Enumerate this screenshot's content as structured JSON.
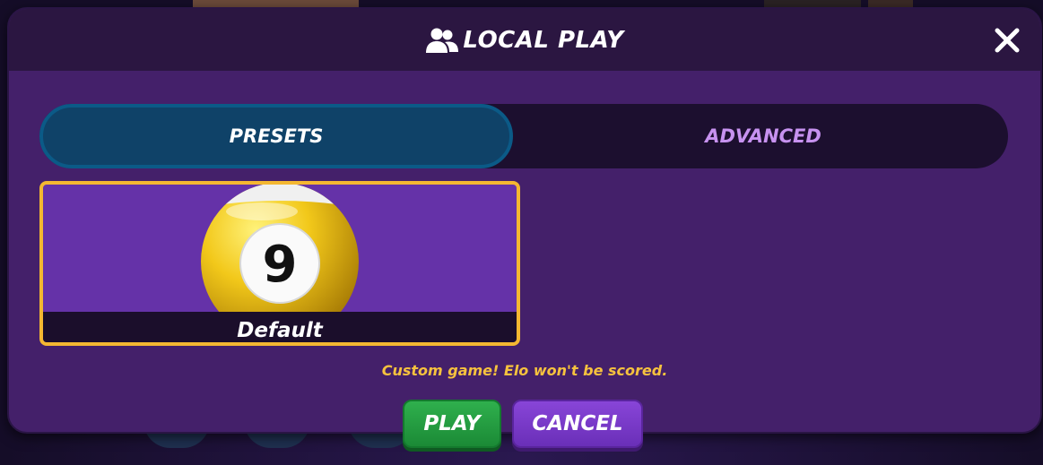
{
  "dialog": {
    "title": "LOCAL PLAY",
    "title_icon": "users-icon",
    "close_icon": "close-icon"
  },
  "tabs": [
    {
      "label": "PRESETS",
      "active": true
    },
    {
      "label": "ADVANCED",
      "active": false
    }
  ],
  "presets": [
    {
      "label": "Default",
      "ball_number": "9",
      "selected": true
    }
  ],
  "notice": "Custom game! Elo won't be scored.",
  "buttons": {
    "play": "PLAY",
    "cancel": "CANCEL"
  },
  "colors": {
    "dialog_bg": "#44206a",
    "header_bg": "#2b1641",
    "tab_active": "#0f4268",
    "tab_inactive_text": "#c792f0",
    "card_border": "#f4b731",
    "card_bg": "#6532a8",
    "notice_text": "#f6c23e",
    "play_button": "#1f9a3d",
    "cancel_button": "#7a3bc8"
  }
}
